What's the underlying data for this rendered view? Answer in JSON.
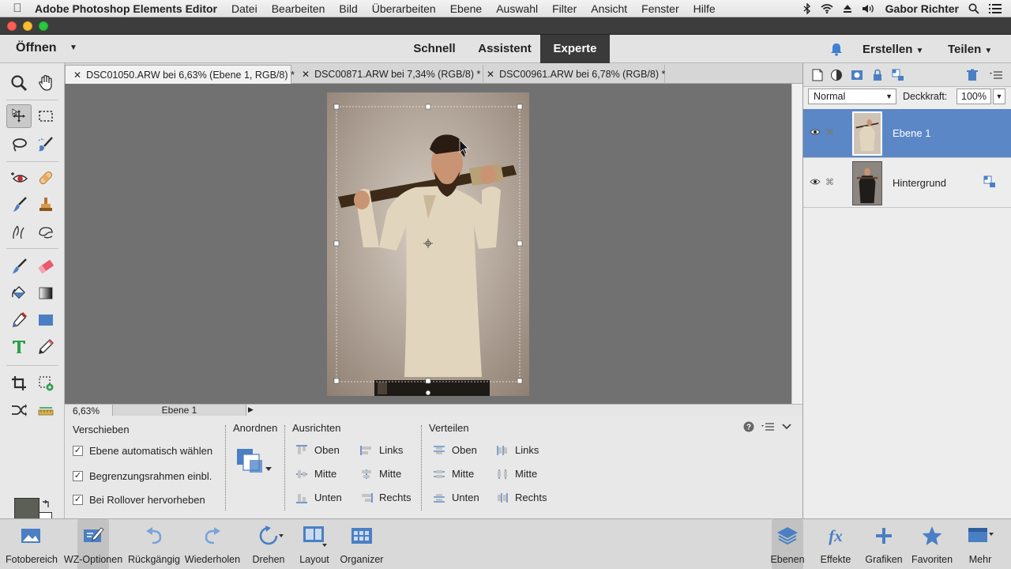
{
  "menubar": {
    "app_name": "Adobe Photoshop Elements Editor",
    "menus": [
      "Datei",
      "Bearbeiten",
      "Bild",
      "Überarbeiten",
      "Ebene",
      "Auswahl",
      "Filter",
      "Ansicht",
      "Fenster",
      "Hilfe"
    ],
    "user": "Gabor Richter"
  },
  "modebar": {
    "open_label": "Öffnen",
    "modes": [
      "Schnell",
      "Assistent",
      "Experte"
    ],
    "active_mode": "Experte",
    "create_label": "Erstellen",
    "share_label": "Teilen"
  },
  "tabs": [
    {
      "label": "DSC01050.ARW bei 6,63% (Ebene 1, RGB/8) *",
      "active": true
    },
    {
      "label": "DSC00871.ARW bei 7,34% (RGB/8) *",
      "active": false
    },
    {
      "label": "DSC00961.ARW bei 6,78% (RGB/8) *",
      "active": false
    }
  ],
  "status": {
    "zoom": "6,63%",
    "layer": "Ebene 1"
  },
  "options": {
    "tool_name": "Verschieben",
    "checkboxes": [
      {
        "label": "Ebene automatisch wählen",
        "checked": true
      },
      {
        "label": "Begrenzungsrahmen einbl.",
        "checked": true
      },
      {
        "label": "Bei Rollover hervorheben",
        "checked": true
      }
    ],
    "arrange_title": "Anordnen",
    "align_title": "Ausrichten",
    "align_col1": [
      "Oben",
      "Mitte",
      "Unten"
    ],
    "align_col2": [
      "Links",
      "Mitte",
      "Rechts"
    ],
    "distribute_title": "Verteilen",
    "distribute_col1": [
      "Oben",
      "Mitte",
      "Unten"
    ],
    "distribute_col2": [
      "Links",
      "Mitte",
      "Rechts"
    ]
  },
  "layers_panel": {
    "blend_mode": "Normal",
    "opacity_label": "Deckkraft:",
    "opacity_value": "100%",
    "layers": [
      {
        "name": "Ebene 1",
        "selected": true
      },
      {
        "name": "Hintergrund",
        "selected": false
      }
    ]
  },
  "bottombar": {
    "left": [
      "Fotobereich",
      "WZ-Optionen",
      "Rückgängig",
      "Wiederholen",
      "Drehen",
      "Layout",
      "Organizer"
    ],
    "right": [
      "Ebenen",
      "Effekte",
      "Grafiken",
      "Favoriten",
      "Mehr"
    ]
  },
  "colors": {
    "accent": "#5b87c6",
    "foreground_swatch": "#5b5f56",
    "canvas_bg": "#717171"
  }
}
